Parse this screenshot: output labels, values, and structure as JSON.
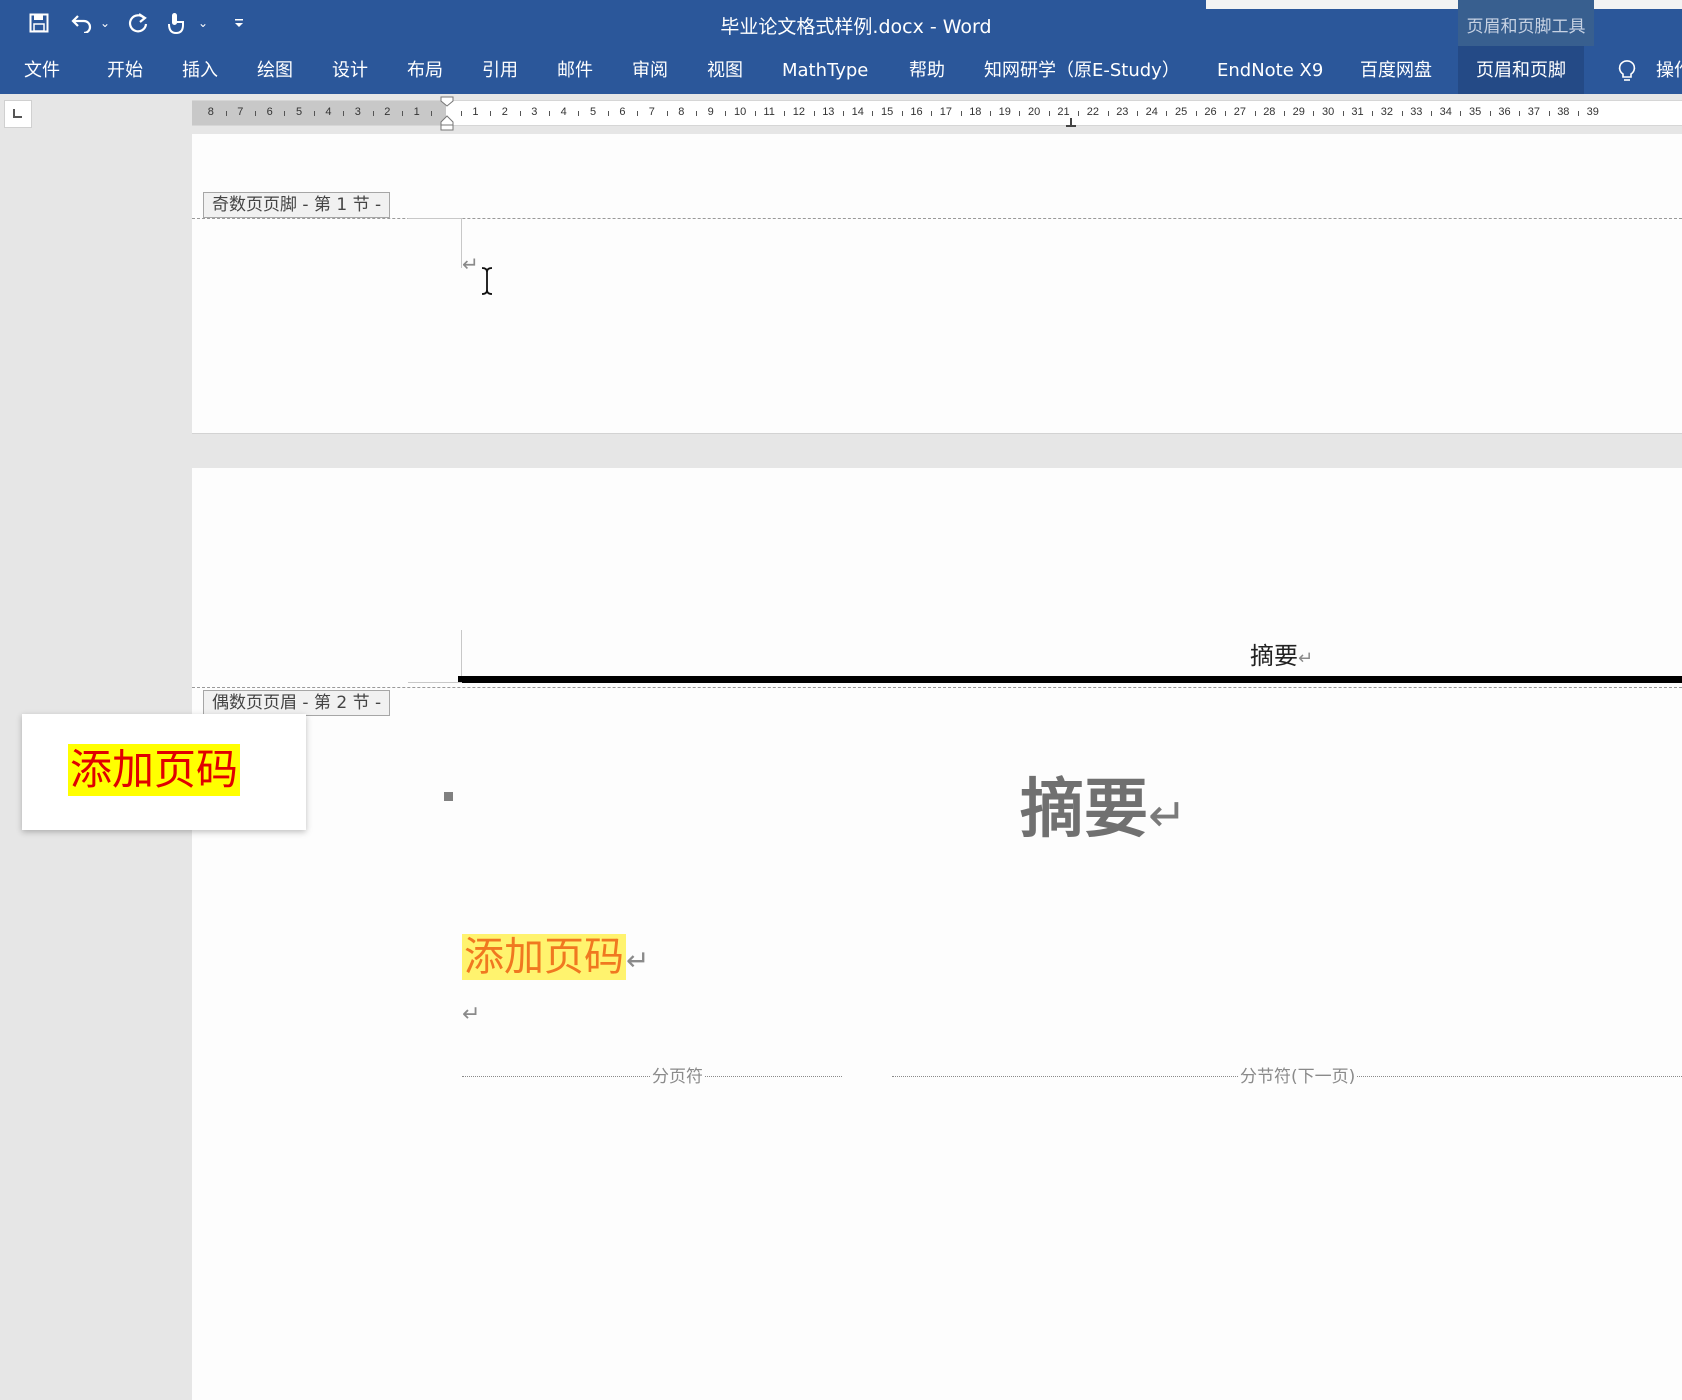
{
  "window": {
    "title": "毕业论文格式样例.docx  -  Word",
    "contextual_group": "页眉和页脚工具"
  },
  "quick_access": {
    "icons": [
      "save-icon",
      "undo-icon",
      "dropdown-icon",
      "redo-icon",
      "touch-mode-icon",
      "dropdown-icon",
      "customize-icon"
    ]
  },
  "ribbon": {
    "tabs": [
      "文件",
      "开始",
      "插入",
      "绘图",
      "设计",
      "布局",
      "引用",
      "邮件",
      "审阅",
      "视图",
      "MathType",
      "帮助",
      "知网研学（原E-Study）",
      "EndNote X9",
      "百度网盘",
      "页眉和页脚",
      "操作"
    ],
    "active_contextual_tab": "页眉和页脚",
    "tell_me_icon": "lightbulb-icon"
  },
  "ruler": {
    "left_numbers": [
      "8",
      "7",
      "6",
      "5",
      "4",
      "3",
      "2",
      "1"
    ],
    "right_numbers": [
      "1",
      "2",
      "3",
      "4",
      "5",
      "6",
      "7",
      "8",
      "9",
      "10",
      "11",
      "12",
      "13",
      "14",
      "15",
      "16",
      "17",
      "18",
      "19",
      "20",
      "21",
      "22",
      "23",
      "24",
      "25",
      "26",
      "27",
      "28",
      "29",
      "30",
      "31",
      "32",
      "33",
      "34",
      "35",
      "36",
      "37",
      "38",
      "39"
    ]
  },
  "document": {
    "page1": {
      "footer_label": "奇数页页脚 - 第 1 节 -",
      "paragraph_mark": "↵"
    },
    "page2": {
      "header_text": "摘要",
      "header_label": "偶数页页眉 - 第 2 节 -",
      "body_title": "摘要",
      "highlighted_text": "添加页码",
      "paragraph_mark": "↵",
      "page_break_label": "分页符",
      "section_break_label": "分节符(下一页)"
    }
  },
  "callout": {
    "text": "添加页码",
    "highlight_color": "#ffff00",
    "text_color": "#e00000"
  },
  "colors": {
    "ribbon": "#2b579a",
    "highlight_in_doc": "#fff36e",
    "highlight_text_in_doc": "#f07820"
  }
}
